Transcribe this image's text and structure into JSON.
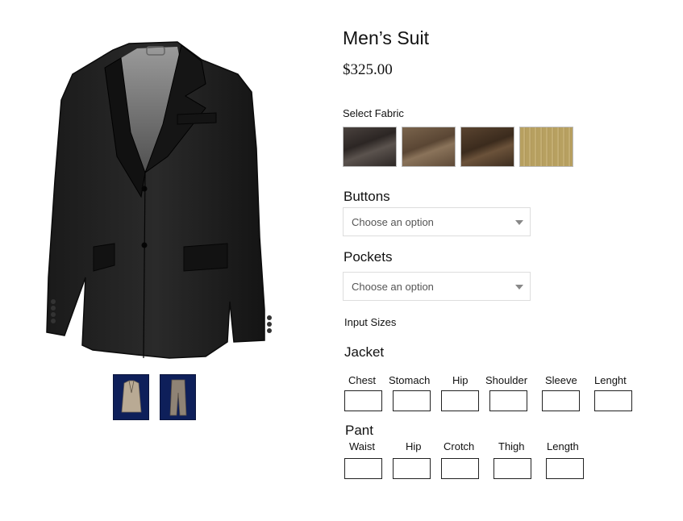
{
  "product": {
    "title": "Men’s Suit",
    "price": "$325.00"
  },
  "gallery": {
    "main_image": "black-suit-jacket",
    "thumbnails": [
      {
        "name": "jacket-thumbnail",
        "bg": "#0e1f5a"
      },
      {
        "name": "pants-thumbnail",
        "bg": "#0e1f5a"
      }
    ]
  },
  "fabric": {
    "label": "Select Fabric",
    "swatches": [
      "dark-grey-fabric",
      "brown-fabric",
      "dark-brown-fabric",
      "tan-pinstripe-fabric"
    ]
  },
  "buttons": {
    "label": "Buttons",
    "placeholder": "Choose an option"
  },
  "pockets": {
    "label": "Pockets",
    "placeholder": "Choose an option"
  },
  "sizes": {
    "label": "Input Sizes",
    "jacket": {
      "label": "Jacket",
      "fields": [
        "Chest",
        "Stomach",
        "Hip",
        "Shoulder",
        "Sleeve",
        "Lenght"
      ]
    },
    "pant": {
      "label": "Pant",
      "fields": [
        "Waist",
        "Hip",
        "Crotch",
        "Thigh",
        "Length"
      ]
    }
  }
}
